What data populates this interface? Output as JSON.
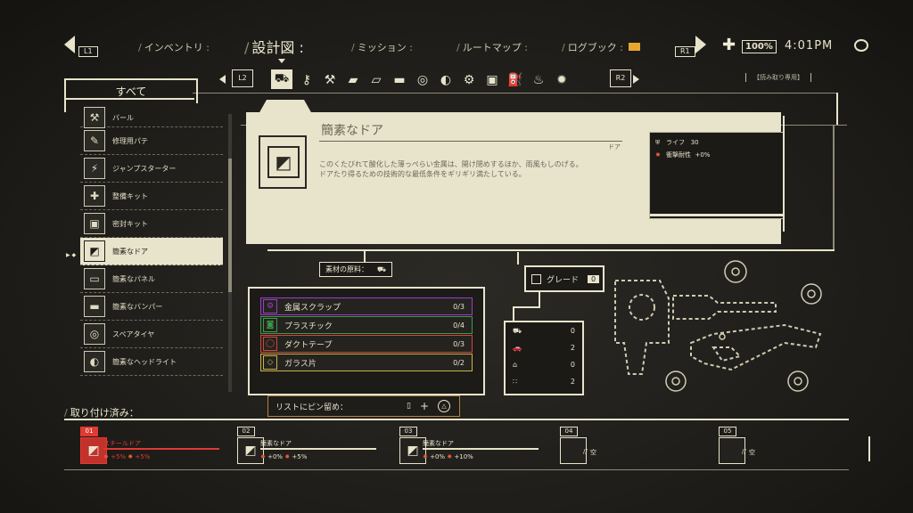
{
  "nav": {
    "l1": "L1",
    "r1": "R1",
    "tabs": [
      {
        "label": "インベントリ",
        "key": "inventory"
      },
      {
        "label": "設計図",
        "key": "blueprints"
      },
      {
        "label": "ミッション",
        "key": "missions"
      },
      {
        "label": "ルートマップ",
        "key": "route-map"
      },
      {
        "label": "ログブック",
        "key": "logbook"
      }
    ],
    "health_percent": "100%",
    "time": "4:01PM"
  },
  "category": {
    "l2": "L2",
    "r2": "R2",
    "read_only": "【読み取り専用】",
    "icons": [
      "car-door-icon",
      "wrench-key-icon",
      "tools-icon",
      "plate-icon",
      "panel-icon",
      "bumper-icon",
      "tire-icon",
      "headlight-icon",
      "engine-icon",
      "battery-icon",
      "fuel-icon",
      "spray-icon",
      "gear-icon"
    ]
  },
  "sidebar": {
    "title": "すべて",
    "items": [
      {
        "label": "バール",
        "icon": "crowbar-icon",
        "glyph": "⚒"
      },
      {
        "label": "修理用パテ",
        "icon": "putty-icon",
        "glyph": "✎"
      },
      {
        "label": "ジャンプスターター",
        "icon": "jump-starter-icon",
        "glyph": "⚡"
      },
      {
        "label": "整備キット",
        "icon": "repair-kit-icon",
        "glyph": "✚"
      },
      {
        "label": "密封キット",
        "icon": "seal-kit-icon",
        "glyph": "▣"
      },
      {
        "label": "簡素なドア",
        "icon": "door-icon",
        "glyph": "◩",
        "selected": true
      },
      {
        "label": "簡素なパネル",
        "icon": "panel-icon",
        "glyph": "▭"
      },
      {
        "label": "簡素なバンパー",
        "icon": "bumper-icon",
        "glyph": "▬"
      },
      {
        "label": "スペアタイヤ",
        "icon": "tire-icon",
        "glyph": "◎"
      },
      {
        "label": "簡素なヘッドライト",
        "icon": "headlight-icon",
        "glyph": "◐"
      }
    ]
  },
  "detail": {
    "title": "簡素なドア",
    "subtitle": "ドア",
    "description_1": "このくたびれて酸化した薄っぺらい金属は、開け閉めするほか、雨風もしのげる。",
    "description_2": "ドアたり得るための技術的な最低条件をギリギリ満たしている。",
    "stats": [
      {
        "label": "ライフ",
        "value": "30",
        "icon": "shield-icon"
      },
      {
        "label": "衝撃耐性",
        "value": "+0%",
        "icon": "impact-icon"
      }
    ]
  },
  "materials": {
    "header": "素材の原料：",
    "rows": [
      {
        "name": "金属スクラップ",
        "count": "0/3",
        "color": "#9b3fc6",
        "icon": "metal-scrap-icon",
        "glyph": "⚙"
      },
      {
        "name": "プラスチック",
        "count": "0/4",
        "color": "#3e9a48",
        "icon": "plastic-icon",
        "glyph": "◙"
      },
      {
        "name": "ダクトテープ",
        "count": "0/3",
        "color": "#d2473c",
        "icon": "duct-tape-icon",
        "glyph": "◯"
      },
      {
        "name": "ガラス片",
        "count": "0/2",
        "color": "#c9b448",
        "icon": "glass-icon",
        "glyph": "◇"
      }
    ]
  },
  "pin": {
    "label": "リストにピン留め："
  },
  "grade": {
    "label": "グレード",
    "value": "0"
  },
  "cost": [
    {
      "icon": "vehicle-icon",
      "value": "0"
    },
    {
      "icon": "car-icon",
      "value": "2"
    },
    {
      "icon": "garage-icon",
      "value": "0"
    },
    {
      "icon": "count-icon",
      "value": "2"
    }
  ],
  "installed": {
    "header": "取り付け済み：",
    "slots": [
      {
        "num": "01",
        "name": "スチールドア",
        "stat1": "+5%",
        "stat2": "+5%",
        "active": true
      },
      {
        "num": "02",
        "name": "簡素なドア",
        "stat1": "+0%",
        "stat2": "+5%"
      },
      {
        "num": "03",
        "name": "簡素なドア",
        "stat1": "+0%",
        "stat2": "+10%"
      },
      {
        "num": "04",
        "name": "空"
      },
      {
        "num": "05",
        "name": "空"
      }
    ]
  },
  "colors": {
    "accent": "#e8e4cc",
    "danger": "#e03a34",
    "pin_border": "#b6823a",
    "mail": "#e7a72f"
  }
}
